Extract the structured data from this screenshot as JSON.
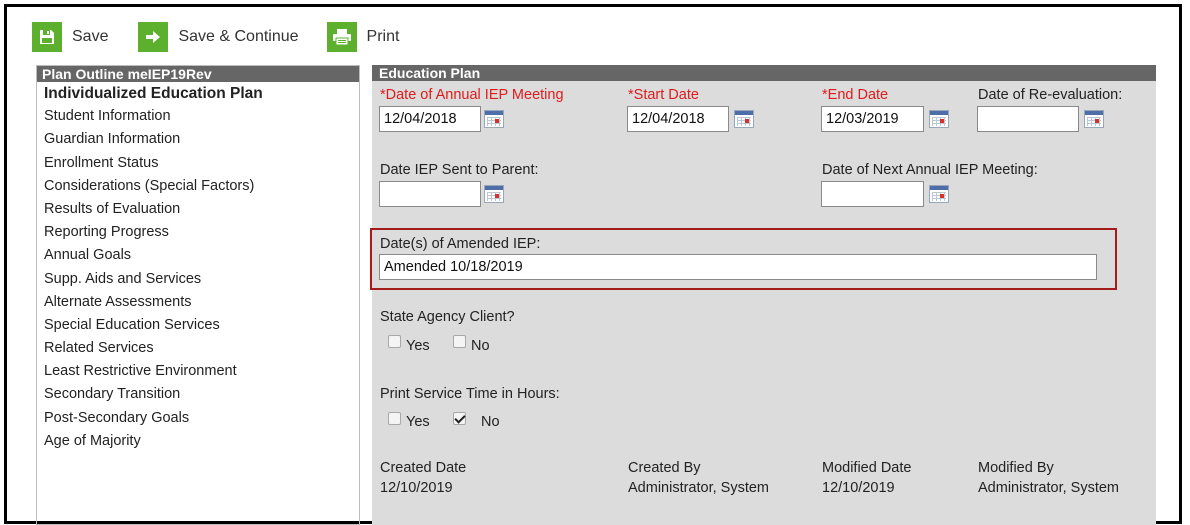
{
  "toolbar": {
    "save_label": "Save",
    "save_continue_label": "Save & Continue",
    "print_label": "Print",
    "accent_color": "#5db02d"
  },
  "outline": {
    "title": "Plan Outline meIEP19Rev",
    "items": [
      {
        "label": "Individualized Education Plan",
        "active": true
      },
      {
        "label": "Student Information"
      },
      {
        "label": "Guardian Information"
      },
      {
        "label": "Enrollment Status"
      },
      {
        "label": "Considerations (Special Factors)"
      },
      {
        "label": "Results of Evaluation"
      },
      {
        "label": "Reporting Progress"
      },
      {
        "label": "Annual Goals"
      },
      {
        "label": "Supp. Aids and Services"
      },
      {
        "label": "Alternate Assessments"
      },
      {
        "label": "Special Education Services"
      },
      {
        "label": "Related Services"
      },
      {
        "label": "Least Restrictive Environment"
      },
      {
        "label": "Secondary Transition"
      },
      {
        "label": "Post-Secondary Goals"
      },
      {
        "label": "Age of Majority"
      }
    ]
  },
  "plan": {
    "title": "Education Plan",
    "annual_iep_label": "*Date of Annual IEP Meeting",
    "annual_iep_value": "12/04/2018",
    "start_label": "*Start Date",
    "start_value": "12/04/2018",
    "end_label": "*End Date",
    "end_value": "12/03/2019",
    "reeval_label": "Date of Re-evaluation:",
    "reeval_value": "",
    "sent_label": "Date IEP Sent to Parent:",
    "sent_value": "",
    "next_label": "Date of Next Annual IEP Meeting:",
    "next_value": "",
    "amended_label": "Date(s) of Amended IEP:",
    "amended_value": "Amended 10/18/2019",
    "agency_label": "State Agency Client?",
    "agency_yes": "Yes",
    "agency_no": "No",
    "hours_label": "Print Service Time in Hours:",
    "hours_yes": "Yes",
    "hours_no": "No",
    "created_date_label": "Created Date",
    "created_date_value": "12/10/2019",
    "created_by_label": "Created By",
    "created_by_value": "Administrator, System",
    "modified_date_label": "Modified Date",
    "modified_date_value": "12/10/2019",
    "modified_by_label": "Modified By",
    "modified_by_value": "Administrator, System",
    "required_color": "#e01b1b",
    "highlight_color": "#a31c1c"
  }
}
